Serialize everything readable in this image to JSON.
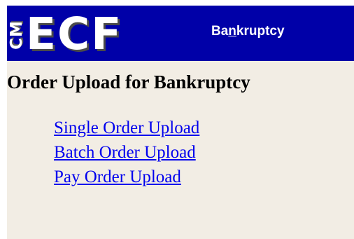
{
  "header": {
    "logo_cm": "CM",
    "logo_ecf": "ECF",
    "court_label": {
      "before": "Ba",
      "accel": "n",
      "after": "kruptcy"
    }
  },
  "page": {
    "title": "Order Upload for Bankruptcy"
  },
  "links": [
    {
      "label": "Single Order Upload"
    },
    {
      "label": "Batch Order Upload"
    },
    {
      "label": "Pay Order Upload"
    }
  ],
  "colors": {
    "header_bg": "#0000a8",
    "page_bg": "#f2ede4",
    "link": "#0000ee"
  }
}
